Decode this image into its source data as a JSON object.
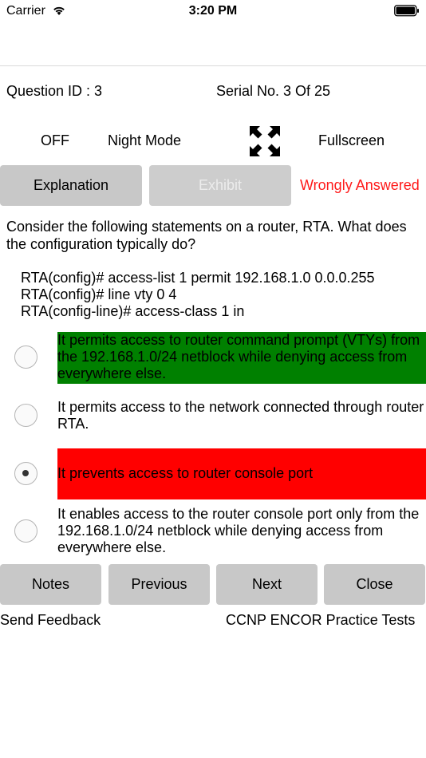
{
  "status_bar": {
    "carrier": "Carrier",
    "time": "3:20 PM"
  },
  "question_info": {
    "question_id": "Question ID : 3",
    "serial": "Serial No. 3 Of 25"
  },
  "controls": {
    "night_mode_state": "OFF",
    "night_mode_label": "Night Mode",
    "fullscreen_label": "Fullscreen"
  },
  "actions": {
    "explanation_label": "Explanation",
    "exhibit_label": "Exhibit",
    "result_text": "Wrongly Answered",
    "result_color": "#ff1a1a"
  },
  "question": {
    "text": "Consider the following statements on a router, RTA. What does the configuration typically do?",
    "code_lines": [
      "RTA(config)# access-list 1 permit 192.168.1.0 0.0.0.255",
      "RTA(config)# line vty 0 4",
      "RTA(config-line)# access-class 1 in"
    ]
  },
  "options": [
    {
      "text": "It permits access to router command prompt (VTYs) from the 192.168.1.0/24 netblock while denying access from everywhere else.",
      "status": "correct",
      "selected": false,
      "highlight_color": "#008000"
    },
    {
      "text": "It permits access to the network connected through router RTA.",
      "status": "none",
      "selected": false
    },
    {
      "text": "It prevents access to router console port",
      "status": "wrong",
      "selected": true,
      "highlight_color": "#ff0000"
    },
    {
      "text": "It enables access to the router console port only from the 192.168.1.0/24 netblock while denying access from everywhere else.",
      "status": "none",
      "selected": false
    }
  ],
  "footer": {
    "notes_label": "Notes",
    "previous_label": "Previous",
    "next_label": "Next",
    "close_label": "Close",
    "feedback_label": "Send Feedback",
    "app_name": "CCNP ENCOR Practice Tests"
  },
  "icons": {
    "wifi": "wifi-icon",
    "battery": "battery-icon",
    "fullscreen": "fullscreen-arrows-icon"
  }
}
